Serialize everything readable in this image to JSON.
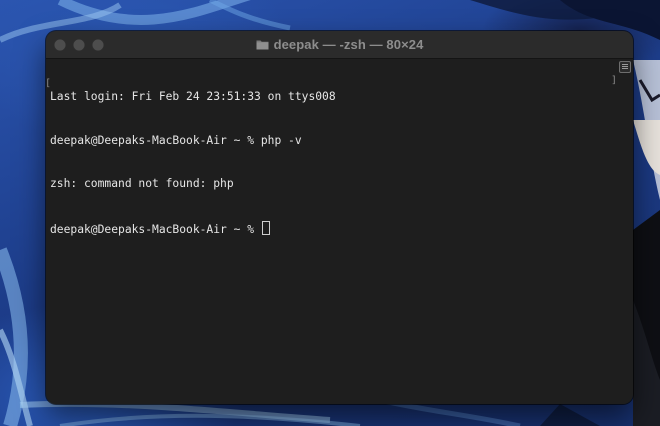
{
  "window": {
    "title": "deepak — -zsh — 80×24",
    "title_icon": "folder-icon"
  },
  "terminal": {
    "lines": [
      "Last login: Fri Feb 24 23:51:33 on ttys008",
      "deepak@Deepaks-MacBook-Air ~ % php -v",
      "zsh: command not found: php",
      "deepak@Deepaks-MacBook-Air ~ % "
    ]
  },
  "colors": {
    "terminal_background": "#1e1e1e",
    "terminal_text": "#e6e6e6",
    "titlebar": "#2b2b2b",
    "wallpaper_blue": "#1f3f86"
  }
}
